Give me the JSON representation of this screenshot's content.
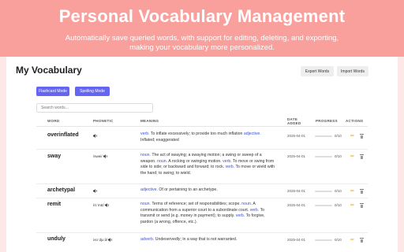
{
  "hero": {
    "title": "Personal Vocabulary Management",
    "subtitle": "Automatically save queried words, with support for editing, deleting, and exporting, making your vocabulary more personalized."
  },
  "panel": {
    "title": "My Vocabulary",
    "export_label": "Export Words",
    "import_label": "Import Words",
    "flashcard_label": "Flashcard Mode",
    "spelling_label": "Spelling Mode",
    "search_placeholder": "Search words..."
  },
  "columns": {
    "word": "WORD",
    "phonetic": "PHONETIC",
    "meaning": "MEANING",
    "date": "DATE ADDED",
    "progress": "PROGRESS",
    "actions": "ACTIONS"
  },
  "rows": [
    {
      "word": "overinflated",
      "phonetic": "",
      "date": "2025-04-01",
      "progress_text": "0/10",
      "progress_fraction": 0.0
    },
    {
      "word": "sway",
      "phonetic": "/swei/",
      "date": "2025-04-01",
      "progress_text": "0/10",
      "progress_fraction": 0.0
    },
    {
      "word": "archetypal",
      "phonetic": "",
      "date": "2025-04-01",
      "progress_text": "0/10",
      "progress_fraction": 0.0
    },
    {
      "word": "remit",
      "phonetic": "/rɪˈmɪt/",
      "date": "2025-04-01",
      "progress_text": "0/10",
      "progress_fraction": 0.0
    },
    {
      "word": "unduly",
      "phonetic": "/ʌnˈdjuːli/",
      "date": "2025-04-01",
      "progress_text": "0/10",
      "progress_fraction": 0.0
    }
  ],
  "meanings": {
    "r0_pos1": "verb.",
    "r0_t1": " To inflate excessively; to provide too much inflation ",
    "r0_pos2": "adjective.",
    "r0_t2": " Inflated; exaggerated",
    "r1_pos1": "noun.",
    "r1_t1": " The act of swaying; a swaying motion; a swing or sweep of a weapon. ",
    "r1_pos2": "noun.",
    "r1_t2": " A rocking or swinging motion. ",
    "r1_pos3": "verb.",
    "r1_t3": " To move or swing from side to side; or backward and forward; to rock. ",
    "r1_pos4": "verb.",
    "r1_t4": " To move or wield with the hand; to swing; to wield.",
    "r2_pos1": "adjective.",
    "r2_t1": " Of or pertaining to an archetype.",
    "r3_pos1": "noun.",
    "r3_t1": " Terms of reference; set of responsibilities; scope. ",
    "r3_pos2": "noun.",
    "r3_t2": " A communication from a superior court to a subordinate court. ",
    "r3_pos3": "verb.",
    "r3_t3": " To transmit or send (e.g. money in payment); to supply. ",
    "r3_pos4": "verb.",
    "r3_t4": " To forgive, pardon (a wrong, offence, etc.).",
    "r4_pos1": "adverb.",
    "r4_t1": " Undeservedly; in a way that is not warranted."
  },
  "icons": {
    "speaker": "speaker-icon",
    "edit": "pencil-icon",
    "delete": "trash-icon"
  },
  "colors": {
    "hero_bg": "#f9a09c",
    "accent": "#6466f1",
    "pos": "#3b4fd8",
    "page_bg": "#fde8e8"
  }
}
